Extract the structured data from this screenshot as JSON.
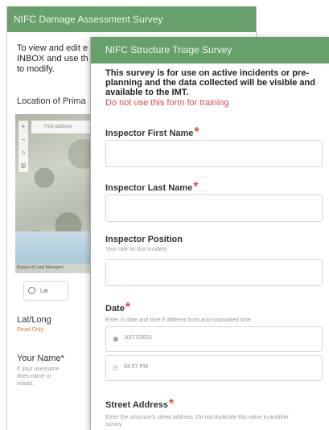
{
  "back_survey": {
    "title": "NIFC Damage Assessment Survey",
    "intro": "To view and edit e INBOX and use th point to modify.",
    "location_label": "Location of Prima",
    "map": {
      "search_placeholder": "Find address",
      "attribution": "Bureau of Land Managem"
    },
    "location_button": "Lat",
    "latlong_label": "Lat/Long",
    "latlong_readonly": "Read Only",
    "your_name_label": "Your Name",
    "your_name_hint": "If your username does name or initials.",
    "required_mark": "*"
  },
  "front_survey": {
    "title": "NIFC Structure Triage Survey",
    "description": "This survey is for use on active incidents or pre-planning and the data collected will be visible and available to the IMT.",
    "warning": "Do not use this form for training",
    "fields": {
      "first_name": {
        "label": "Inspector First Name",
        "required": "*"
      },
      "last_name": {
        "label": "Inspector Last Name",
        "required": "*"
      },
      "position": {
        "label": "Inspector Position",
        "hint": "Your role on this incident"
      },
      "date": {
        "label": "Date",
        "required": "*",
        "hint": "Enter in date and time if different from auto-populated time",
        "date_value": "10/17/2021",
        "time_value": "04:57 PM"
      },
      "street": {
        "label": "Street Address",
        "required": "*",
        "hint": "Enter the structure's street address. Do not duplicate this value in another survey"
      }
    }
  },
  "colors": {
    "header": "#68a06b",
    "required": "#e0484a",
    "readonly": "#e07a2a"
  },
  "icons": {
    "calendar": "calendar-icon",
    "clock": "clock-icon",
    "locate": "locate-icon"
  }
}
